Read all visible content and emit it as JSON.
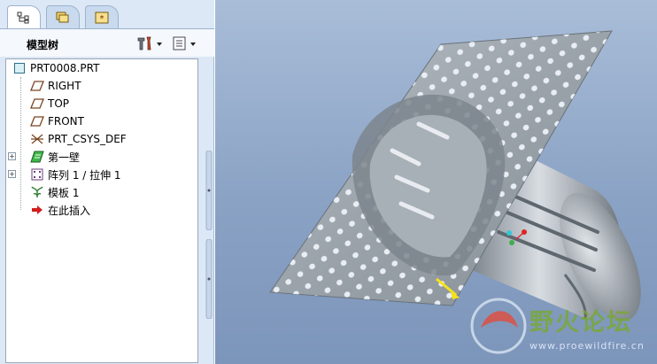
{
  "navigator": {
    "tabs": [
      {
        "name": "model-tree-tab-icon",
        "active": true
      },
      {
        "name": "folder-browser-tab-icon",
        "active": false
      },
      {
        "name": "favorites-tab-icon",
        "active": false
      }
    ],
    "title": "模型树",
    "settings_icon": "tools-icon",
    "show_icon": "list-options-icon"
  },
  "tree": {
    "items": [
      {
        "label": "PRT0008.PRT",
        "icon": "part-icon"
      },
      {
        "label": "RIGHT",
        "icon": "datum-plane-icon"
      },
      {
        "label": "TOP",
        "icon": "datum-plane-icon"
      },
      {
        "label": "FRONT",
        "icon": "datum-plane-icon"
      },
      {
        "label": "PRT_CSYS_DEF",
        "icon": "csys-icon"
      },
      {
        "label": "第一壁",
        "icon": "sheetmetal-wall-icon"
      },
      {
        "label": "阵列 1 / 拉伸 1",
        "icon": "pattern-icon"
      },
      {
        "label": "模板 1",
        "icon": "form-icon"
      },
      {
        "label": "在此插入",
        "icon": "insert-here-arrow-icon"
      }
    ]
  },
  "watermark": {
    "title": "野火论坛",
    "url": "www.proewildfire.cn"
  },
  "colors": {
    "viewport_top": "#a9bdd8",
    "viewport_bottom": "#7c95ba",
    "panel_bg": "#dce8f5",
    "model_gray": "#9ea6ae"
  }
}
